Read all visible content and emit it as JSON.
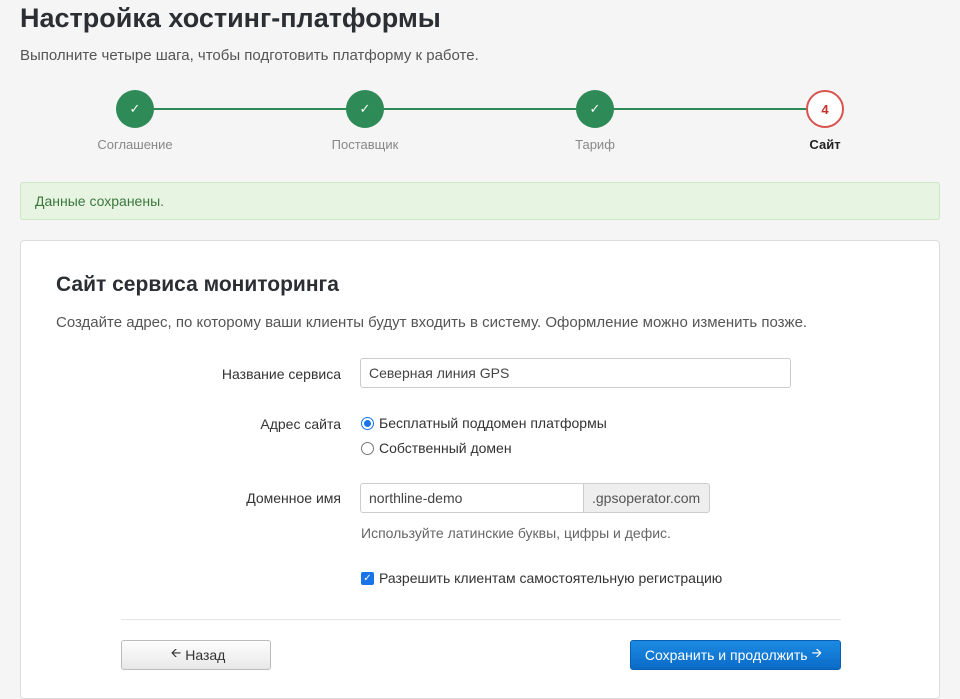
{
  "page": {
    "title": "Настройка хостинг-платформы",
    "subtitle": "Выполните четыре шага, чтобы подготовить платформу к работе."
  },
  "steps": [
    {
      "label": "Соглашение",
      "status": "done",
      "marker": "✓"
    },
    {
      "label": "Поставщик",
      "status": "done",
      "marker": "✓"
    },
    {
      "label": "Тариф",
      "status": "done",
      "marker": "✓"
    },
    {
      "label": "Сайт",
      "status": "current",
      "marker": "4"
    }
  ],
  "alert": {
    "text": "Данные сохранены."
  },
  "panel": {
    "title": "Сайт сервиса мониторинга",
    "description": "Создайте адрес, по которому ваши клиенты будут входить в систему. Оформление можно изменить позже."
  },
  "form": {
    "service_name_label": "Название сервиса",
    "service_name_value": "Северная линия GPS",
    "site_address_label": "Адрес сайта",
    "radio_free_label": "Бесплатный поддомен платформы",
    "radio_own_label": "Собственный домен",
    "selected_address": "free",
    "domain_label": "Доменное имя",
    "domain_value": "northline-demo",
    "domain_suffix": ".gpsoperator.com",
    "domain_help": "Используйте латинские буквы, цифры и дефис.",
    "self_registration_label": "Разрешить клиентам самостоятельную регистрацию",
    "self_registration_checked": true
  },
  "buttons": {
    "back_label": "Назад",
    "save_label": "Сохранить и продолжить"
  },
  "colors": {
    "step_done": "#2e8b57",
    "step_current": "#d9534f",
    "primary": "#1a73e8",
    "alert_bg": "#e6f4e1"
  }
}
